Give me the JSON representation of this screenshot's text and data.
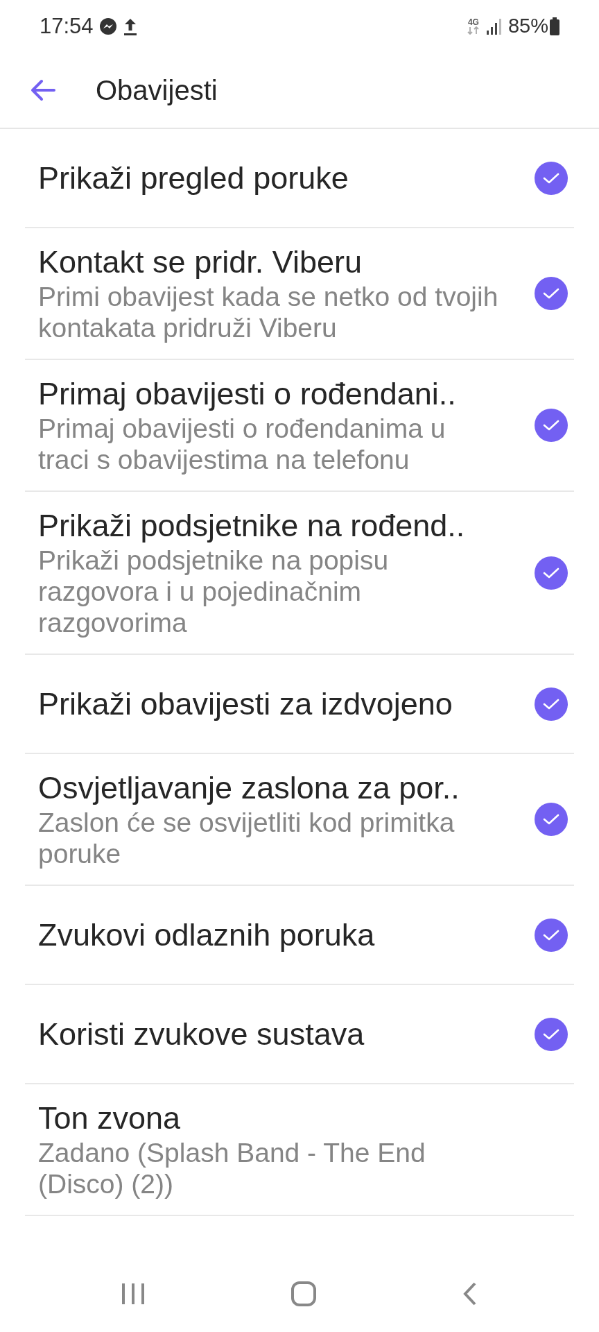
{
  "status_bar": {
    "time": "17:54",
    "battery": "85%",
    "network": "4G"
  },
  "header": {
    "title": "Obavijesti"
  },
  "settings": [
    {
      "kind": "checkbox",
      "title": "Prikaži pregled poruke",
      "checked": true
    },
    {
      "kind": "checkbox",
      "title": "Kontakt se pridr. Viberu",
      "subtitle": "Primi obavijest kada se netko od tvojih kontakata pridruži Viberu",
      "checked": true
    },
    {
      "kind": "checkbox",
      "title": "Primaj obavijesti o rođendani..",
      "subtitle": "Primaj obavijesti o rođendanima u traci s obavijestima na telefonu",
      "checked": true
    },
    {
      "kind": "checkbox",
      "title": "Prikaži podsjetnike na rođend..",
      "subtitle": "Prikaži podsjetnike na popisu razgovora i u pojedinačnim razgovorima",
      "checked": true
    },
    {
      "kind": "checkbox",
      "title": "Prikaži obavijesti za izdvojeno",
      "checked": true
    },
    {
      "kind": "checkbox",
      "title": "Osvjetljavanje zaslona za por..",
      "subtitle": "Zaslon će se osvijetliti kod primitka poruke",
      "checked": true
    },
    {
      "kind": "checkbox",
      "title": "Zvukovi odlaznih poruka",
      "checked": true
    },
    {
      "kind": "checkbox",
      "title": "Koristi zvukove sustava",
      "checked": true
    },
    {
      "kind": "value",
      "title": "Ton zvona",
      "subtitle": "Zadano (Splash Band - The End (Disco) (2))"
    }
  ]
}
